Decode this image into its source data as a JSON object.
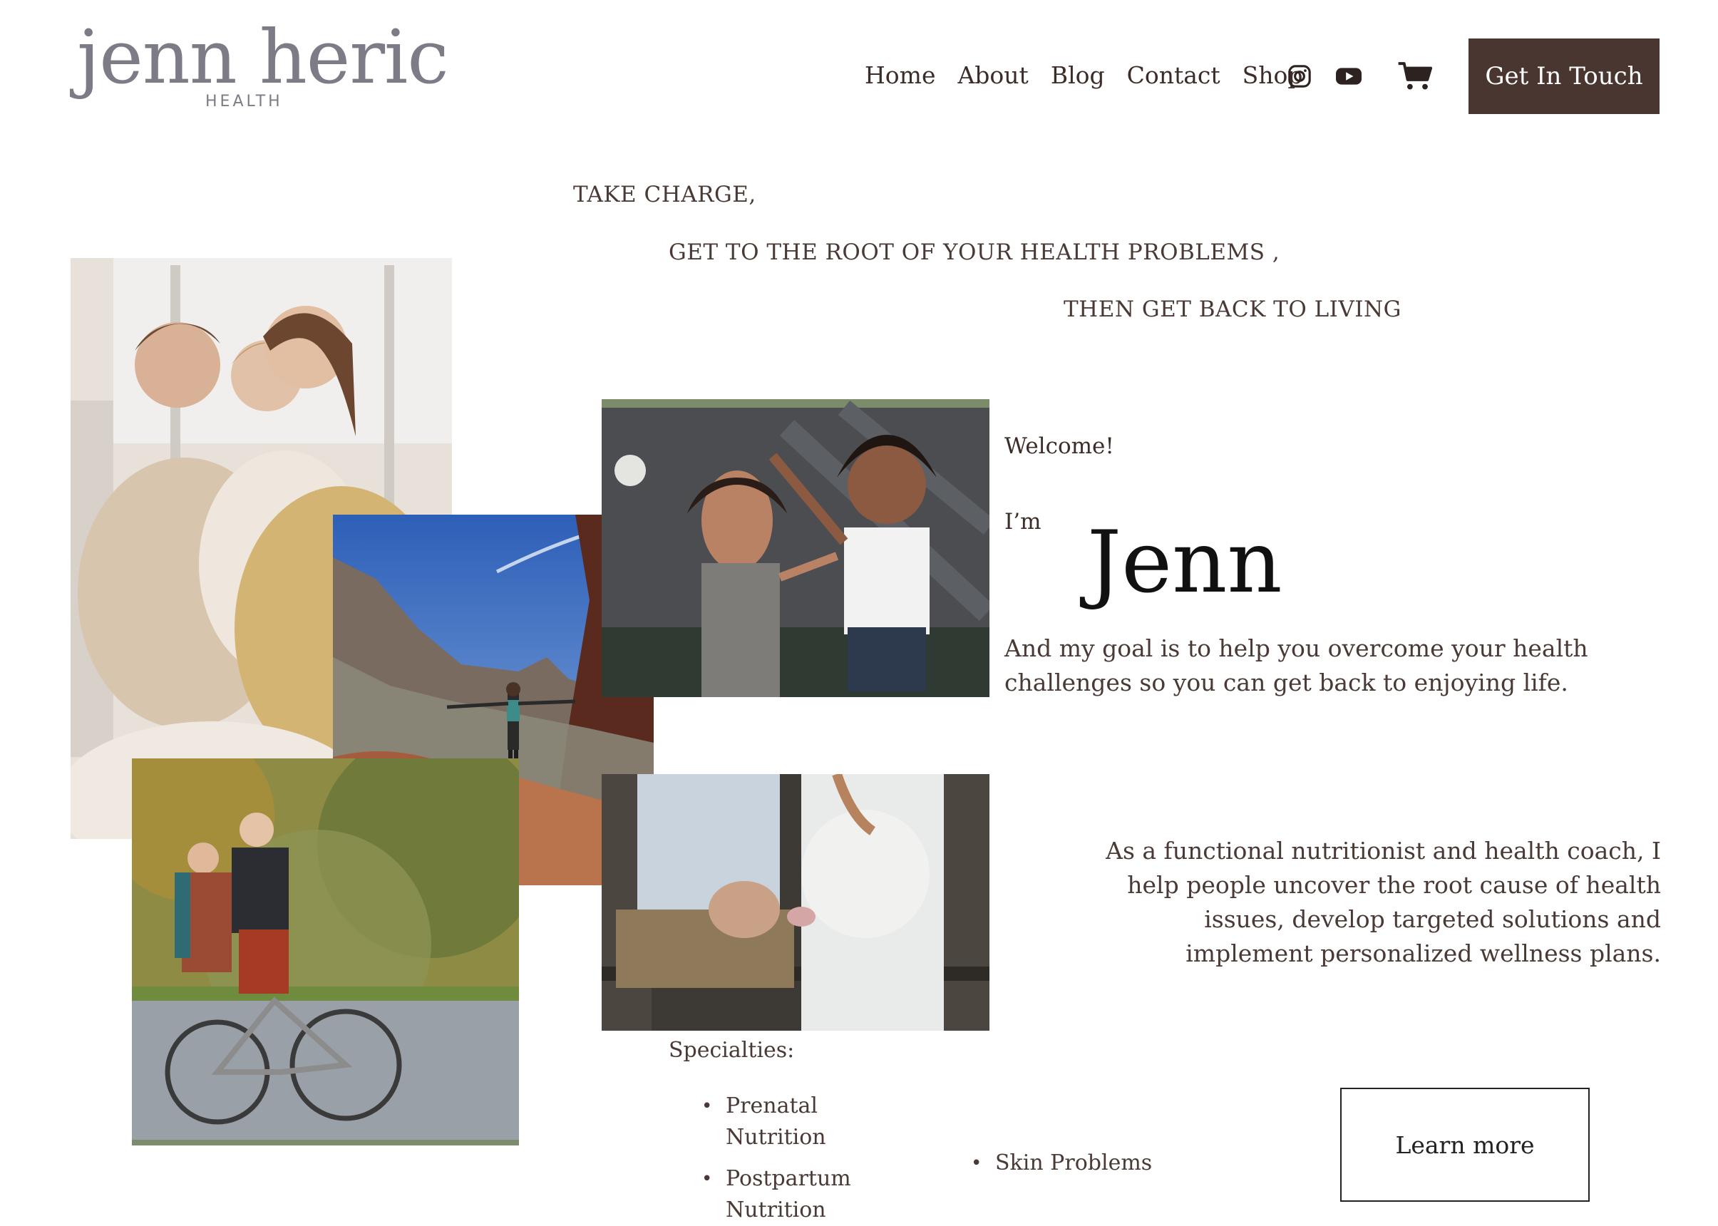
{
  "header": {
    "logo_main": "jenn heric",
    "logo_sub": "HEALTH",
    "nav": [
      "Home",
      "About",
      "Blog",
      "Contact",
      "Shop"
    ],
    "icons": [
      "instagram-icon",
      "youtube-icon",
      "cart-icon"
    ],
    "cta_label": "Get In Touch"
  },
  "hero": {
    "line1": "TAKE CHARGE,",
    "line2": "GET TO THE ROOT OF YOUR HEALTH PROBLEMS ,",
    "line3": "THEN GET BACK TO LIVING"
  },
  "intro": {
    "welcome": "Welcome!",
    "im": "I’m",
    "name": "Jenn",
    "goal": "And my goal is to help you overcome your health challenges so you can get back to enjoying life.",
    "about": "As a functional nutritionist and health coach, I help people uncover the root cause of health issues, develop targeted solutions and implement personalized wellness plans."
  },
  "specialties": {
    "title": "Specialties:",
    "col1": [
      "Prenatal Nutrition",
      "Postpartum Nutrition"
    ],
    "col2": [
      "Skin Problems"
    ]
  },
  "learn_more_label": "Learn more",
  "colors": {
    "brand": "#4a3630",
    "logo": "#7d7c86",
    "text": "#4a3a35",
    "accent_green": "#7c8b6a"
  }
}
